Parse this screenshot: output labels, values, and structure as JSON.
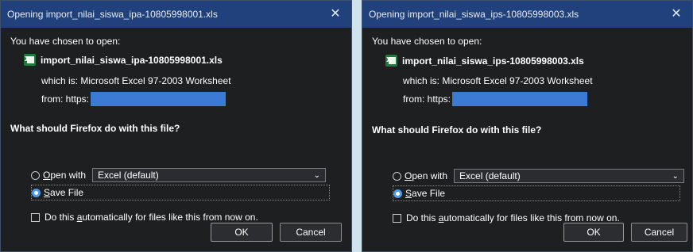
{
  "dialogs": [
    {
      "title": "Opening import_nilai_siswa_ipa-10805998001.xls",
      "close_glyph": "✕",
      "intro": "You have chosen to open:",
      "file_icon": "excel-file-icon",
      "filename": "import_nilai_siswa_ipa-10805998001.xls",
      "which_is": "which is: Microsoft Excel 97-2003 Worksheet",
      "from": "from: https:",
      "question": "What should Firefox do with this file?",
      "open_with": {
        "prefix": "O",
        "rest": "pen with",
        "selected": false
      },
      "app_select": {
        "value": "Excel (default)"
      },
      "save_file": {
        "prefix": "S",
        "rest": "ave File",
        "selected": true
      },
      "auto": {
        "before": "Do this ",
        "accel": "a",
        "after": "utomatically for files like this from now on.",
        "checked": false
      },
      "ok_label": "OK",
      "cancel_label": "Cancel"
    },
    {
      "title": "Opening import_nilai_siswa_ips-10805998003.xls",
      "close_glyph": "✕",
      "intro": "You have chosen to open:",
      "file_icon": "excel-file-icon",
      "filename": "import_nilai_siswa_ips-10805998003.xls",
      "which_is": "which is: Microsoft Excel 97-2003 Worksheet",
      "from": "from: https:",
      "question": "What should Firefox do with this file?",
      "open_with": {
        "prefix": "O",
        "rest": "pen with",
        "selected": false
      },
      "app_select": {
        "value": "Excel (default)"
      },
      "save_file": {
        "prefix": "S",
        "rest": "ave File",
        "selected": true
      },
      "auto": {
        "before": "Do this ",
        "accel": "a",
        "after": "utomatically for files like this from now on.",
        "checked": false
      },
      "ok_label": "OK",
      "cancel_label": "Cancel"
    }
  ],
  "colors": {
    "titlebar": "#21417c",
    "body": "#1e1f21",
    "redaction": "#3b7bd6",
    "radio_checked": "#4a9bf0"
  }
}
